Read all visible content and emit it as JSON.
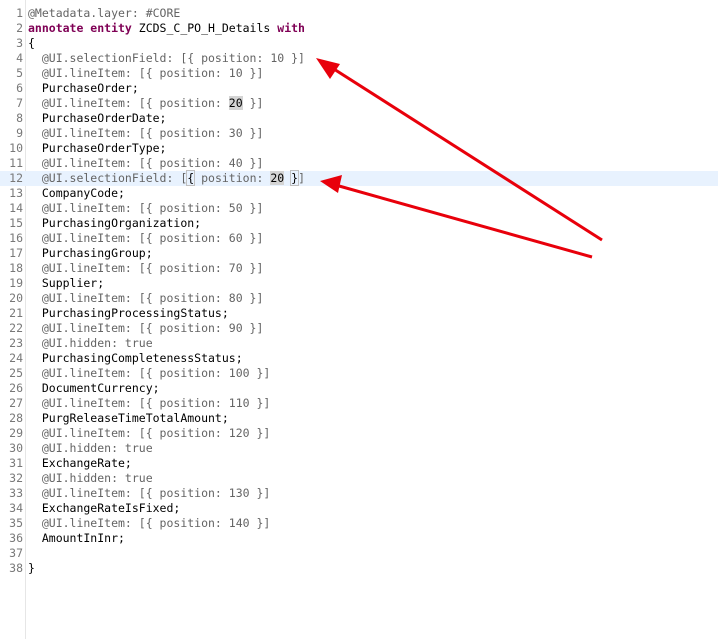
{
  "editor": {
    "lines": [
      {
        "num": "1",
        "tokens": [
          {
            "t": "@Metadata.layer: #CORE",
            "k": "anno"
          }
        ]
      },
      {
        "num": "2",
        "tokens": [
          {
            "t": "annotate entity ",
            "k": "kw"
          },
          {
            "t": "ZCDS_C_PO_H_Details",
            "k": "ident"
          },
          {
            "t": " with",
            "k": "kw"
          }
        ]
      },
      {
        "num": "3",
        "tokens": [
          {
            "t": "{",
            "k": "ident"
          }
        ]
      },
      {
        "num": "4",
        "tokens": [
          {
            "t": "  @UI.selectionField: [{ position: 10 }]",
            "k": "anno"
          }
        ]
      },
      {
        "num": "5",
        "tokens": [
          {
            "t": "  @UI.lineItem: [{ position: 10 }]",
            "k": "anno"
          }
        ]
      },
      {
        "num": "6",
        "tokens": [
          {
            "t": "  PurchaseOrder;",
            "k": "field"
          }
        ]
      },
      {
        "num": "7",
        "tokens": [
          {
            "t": "  @UI.lineItem: [{ position: ",
            "k": "anno"
          },
          {
            "t": "20",
            "k": "hl"
          },
          {
            "t": " }]",
            "k": "anno"
          }
        ]
      },
      {
        "num": "8",
        "tokens": [
          {
            "t": "  PurchaseOrderDate;",
            "k": "field"
          }
        ]
      },
      {
        "num": "9",
        "tokens": [
          {
            "t": "  @UI.lineItem: [{ position: 30 }]",
            "k": "anno"
          }
        ]
      },
      {
        "num": "10",
        "tokens": [
          {
            "t": "  PurchaseOrderType;",
            "k": "field"
          }
        ]
      },
      {
        "num": "11",
        "tokens": [
          {
            "t": "  @UI.lineItem: [{ position: 40 }]",
            "k": "anno"
          }
        ]
      },
      {
        "num": "12",
        "tokens": [
          {
            "t": "  @UI.selectionField: [",
            "k": "anno"
          },
          {
            "t": "{",
            "k": "bracket"
          },
          {
            "t": " position: ",
            "k": "anno"
          },
          {
            "t": "20",
            "k": "hl"
          },
          {
            "t": " ",
            "k": "anno"
          },
          {
            "t": "}",
            "k": "bracket"
          },
          {
            "t": "]",
            "k": "anno"
          }
        ],
        "current": true
      },
      {
        "num": "13",
        "tokens": [
          {
            "t": "  CompanyCode;",
            "k": "field"
          }
        ]
      },
      {
        "num": "14",
        "tokens": [
          {
            "t": "  @UI.lineItem: [{ position: 50 }]",
            "k": "anno"
          }
        ]
      },
      {
        "num": "15",
        "tokens": [
          {
            "t": "  PurchasingOrganization;",
            "k": "field"
          }
        ]
      },
      {
        "num": "16",
        "tokens": [
          {
            "t": "  @UI.lineItem: [{ position: 60 }]",
            "k": "anno"
          }
        ]
      },
      {
        "num": "17",
        "tokens": [
          {
            "t": "  PurchasingGroup;",
            "k": "field"
          }
        ]
      },
      {
        "num": "18",
        "tokens": [
          {
            "t": "  @UI.lineItem: [{ position: 70 }]",
            "k": "anno"
          }
        ]
      },
      {
        "num": "19",
        "tokens": [
          {
            "t": "  Supplier;",
            "k": "field"
          }
        ]
      },
      {
        "num": "20",
        "tokens": [
          {
            "t": "  @UI.lineItem: [{ position: 80 }]",
            "k": "anno"
          }
        ]
      },
      {
        "num": "21",
        "tokens": [
          {
            "t": "  PurchasingProcessingStatus;",
            "k": "field"
          }
        ]
      },
      {
        "num": "22",
        "tokens": [
          {
            "t": "  @UI.lineItem: [{ position: 90 }]",
            "k": "anno"
          }
        ]
      },
      {
        "num": "23",
        "tokens": [
          {
            "t": "  @UI.hidden: true",
            "k": "anno"
          }
        ]
      },
      {
        "num": "24",
        "tokens": [
          {
            "t": "  PurchasingCompletenessStatus;",
            "k": "field"
          }
        ]
      },
      {
        "num": "25",
        "tokens": [
          {
            "t": "  @UI.lineItem: [{ position: 100 }]",
            "k": "anno"
          }
        ]
      },
      {
        "num": "26",
        "tokens": [
          {
            "t": "  DocumentCurrency;",
            "k": "field"
          }
        ]
      },
      {
        "num": "27",
        "tokens": [
          {
            "t": "  @UI.lineItem: [{ position: 110 }]",
            "k": "anno"
          }
        ]
      },
      {
        "num": "28",
        "tokens": [
          {
            "t": "  PurgReleaseTimeTotalAmount;",
            "k": "field"
          }
        ]
      },
      {
        "num": "29",
        "tokens": [
          {
            "t": "  @UI.lineItem: [{ position: 120 }]",
            "k": "anno"
          }
        ]
      },
      {
        "num": "30",
        "tokens": [
          {
            "t": "  @UI.hidden: true",
            "k": "anno"
          }
        ]
      },
      {
        "num": "31",
        "tokens": [
          {
            "t": "  ExchangeRate;",
            "k": "field"
          }
        ]
      },
      {
        "num": "32",
        "tokens": [
          {
            "t": "  @UI.hidden: true",
            "k": "anno"
          }
        ]
      },
      {
        "num": "33",
        "tokens": [
          {
            "t": "  @UI.lineItem: [{ position: 130 }]",
            "k": "anno"
          }
        ]
      },
      {
        "num": "34",
        "tokens": [
          {
            "t": "  ExchangeRateIsFixed;",
            "k": "field"
          }
        ]
      },
      {
        "num": "35",
        "tokens": [
          {
            "t": "  @UI.lineItem: [{ position: 140 }]",
            "k": "anno"
          }
        ]
      },
      {
        "num": "36",
        "tokens": [
          {
            "t": "  AmountInInr;",
            "k": "field"
          }
        ]
      },
      {
        "num": "37",
        "tokens": []
      },
      {
        "num": "38",
        "tokens": [
          {
            "t": "}",
            "k": "ident"
          }
        ]
      }
    ]
  },
  "colors": {
    "annotation": "#646464",
    "keyword": "#7f0055",
    "arrow": "#e8000b",
    "current_line": "#e8f2fe"
  }
}
